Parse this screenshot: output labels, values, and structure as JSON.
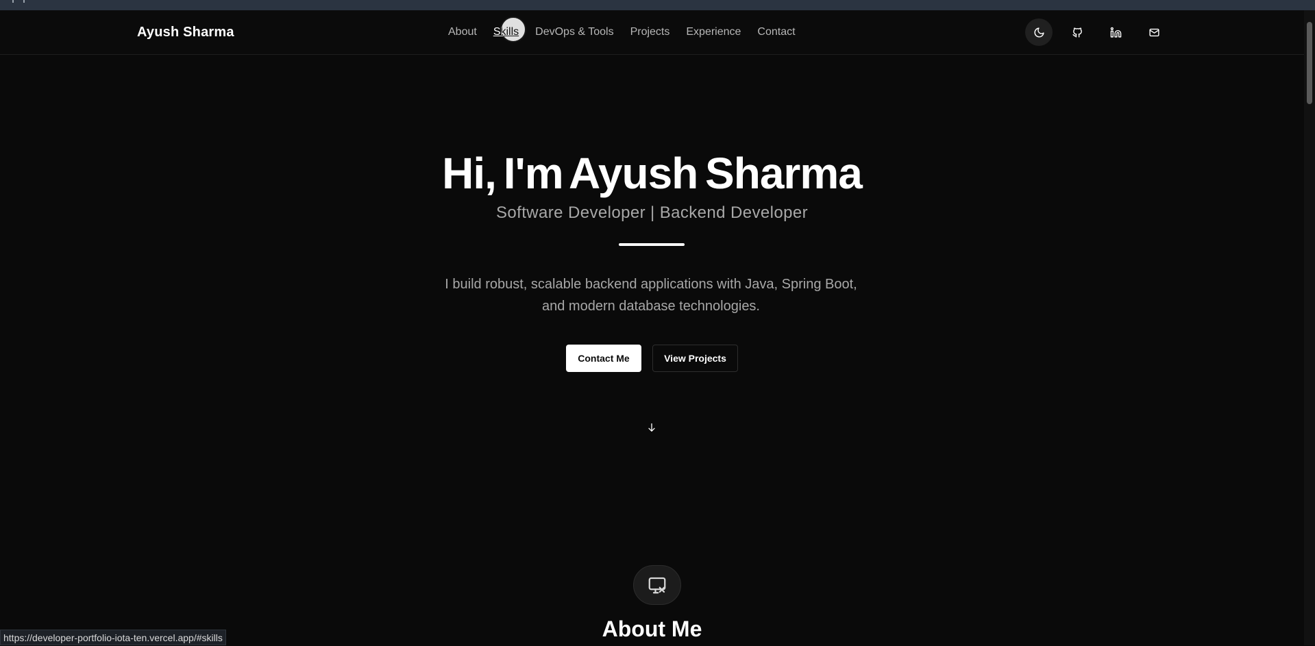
{
  "nav": {
    "brand": "Ayush Sharma",
    "links": [
      "About",
      "Skills",
      "DevOps & Tools",
      "Projects",
      "Experience",
      "Contact"
    ],
    "active": "Skills",
    "icons": [
      "moon-icon",
      "github-icon",
      "linkedin-icon",
      "mail-icon"
    ]
  },
  "hero": {
    "title": "Hi, I'm Ayush Sharma",
    "subtitle": "Software Developer | Backend Developer",
    "description_line1": "I build robust, scalable backend applications with Java, Spring Boot,",
    "description_line2": "and modern database technologies.",
    "primary_button": "Contact Me",
    "secondary_button": "View Projects",
    "scroll_icon": "arrow-down-icon"
  },
  "about": {
    "badge_icon": "screen-share-off-icon",
    "title": "About Me"
  },
  "status_bar": {
    "url": "https://developer-portfolio-iota-ten.vercel.app/#skills"
  },
  "colors": {
    "background": "#0a0a0a",
    "text": "#ffffff",
    "muted": "#a8a8a8"
  }
}
